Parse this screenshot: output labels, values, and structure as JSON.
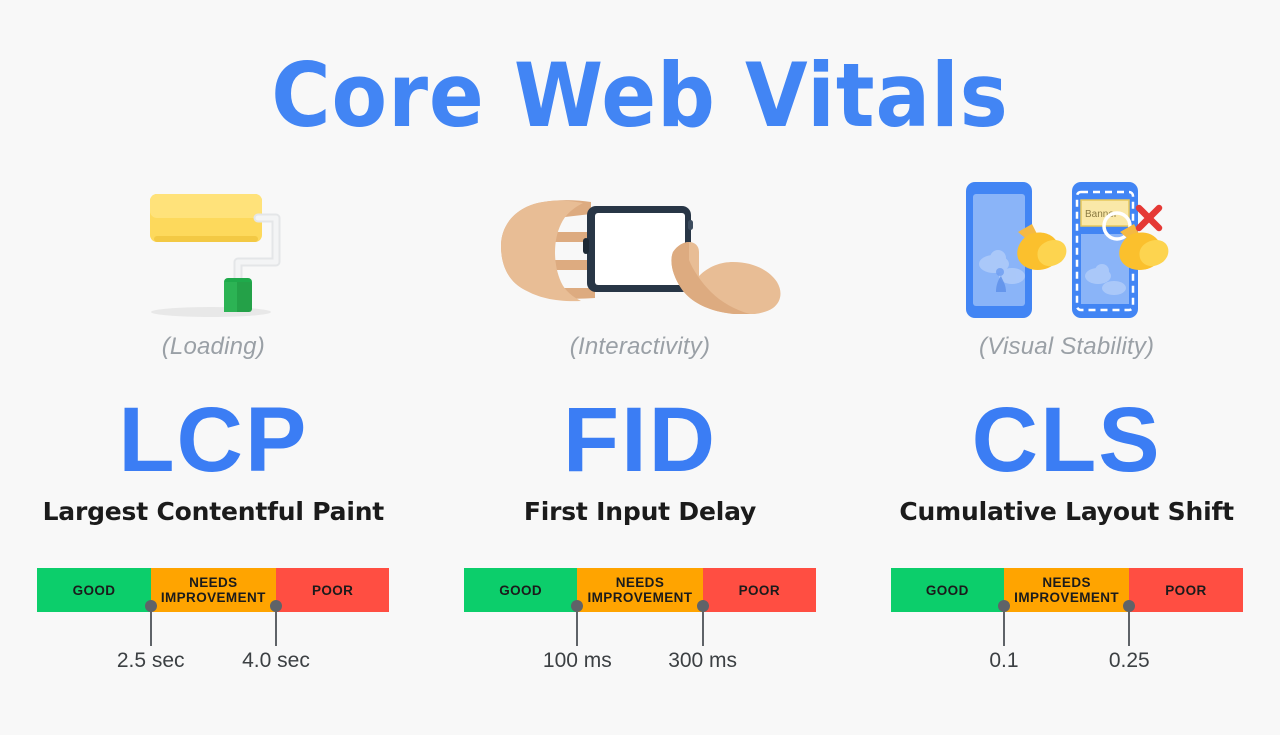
{
  "page": {
    "title": "Core Web Vitals",
    "background_color": "#f8f8f8",
    "accent_color": "#4285f4"
  },
  "legend_colors": {
    "good": "#0cce6b",
    "needs_improvement": "#ffa400",
    "poor": "#ff4e42",
    "pin": "#5f6368",
    "subtitle_gray": "#9aa0a6",
    "fullname_black": "#1b1b1b"
  },
  "metrics": [
    {
      "acronym": "LCP",
      "full_name": "Largest Contentful Paint",
      "subtitle": "(Loading)",
      "icon": "paint-roller-icon",
      "bar": {
        "segments": [
          {
            "label": "GOOD"
          },
          {
            "label": "NEEDS IMPROVEMENT"
          },
          {
            "label": "POOR"
          }
        ],
        "thresholds": [
          {
            "value": "2.5 sec"
          },
          {
            "value": "4.0 sec"
          }
        ]
      }
    },
    {
      "acronym": "FID",
      "full_name": "First Input Delay",
      "subtitle": "(Interactivity)",
      "icon": "hands-tapping-phone-icon",
      "bar": {
        "segments": [
          {
            "label": "GOOD"
          },
          {
            "label": "NEEDS IMPROVEMENT"
          },
          {
            "label": "POOR"
          }
        ],
        "thresholds": [
          {
            "value": "100 ms"
          },
          {
            "value": "300 ms"
          }
        ]
      }
    },
    {
      "acronym": "CLS",
      "full_name": "Cumulative Layout Shift",
      "subtitle": "(Visual Stability)",
      "icon": "layout-shift-phones-icon",
      "icon_text": {
        "banner_label": "Banner"
      },
      "bar": {
        "segments": [
          {
            "label": "GOOD"
          },
          {
            "label": "NEEDS IMPROVEMENT"
          },
          {
            "label": "POOR"
          }
        ],
        "thresholds": [
          {
            "value": "0.1"
          },
          {
            "value": "0.25"
          }
        ]
      }
    }
  ]
}
